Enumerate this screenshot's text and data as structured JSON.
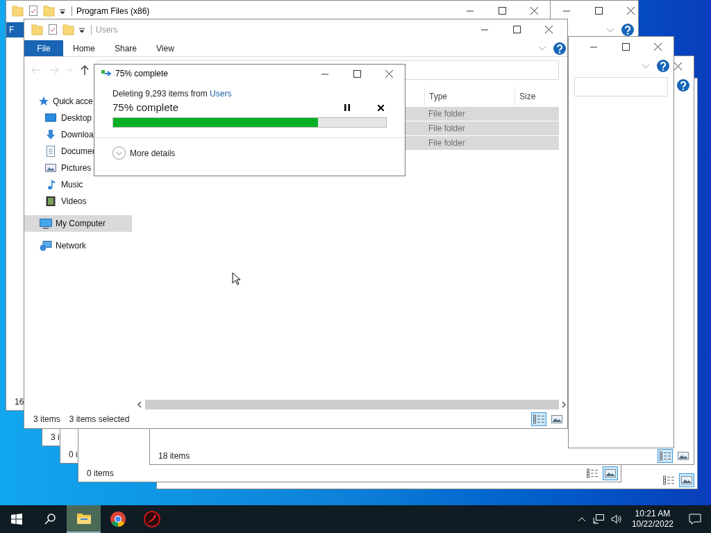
{
  "background_windows": [
    {
      "kind": "edge",
      "details_view": false
    },
    {
      "kind": "explorer",
      "title": "Program Files (x86)",
      "tab": "F",
      "status": "16"
    },
    {
      "kind": "corner"
    },
    {
      "kind": "plain",
      "status": "3 i"
    },
    {
      "kind": "plain",
      "status": "0 i"
    },
    {
      "kind": "plain",
      "status": "0 items",
      "details_view": false
    },
    {
      "kind": "plain",
      "status": "18 items",
      "details_view": true
    },
    {
      "kind": "side"
    }
  ],
  "window": {
    "title": "Users",
    "tabs": [
      {
        "label": "File",
        "selected": true
      },
      {
        "label": "Home",
        "selected": false
      },
      {
        "label": "Share",
        "selected": false
      },
      {
        "label": "View",
        "selected": false
      }
    ],
    "nav": [
      {
        "label": "Quick acce",
        "kind": "star",
        "selected": false
      },
      {
        "label": "Desktop",
        "kind": "desktop",
        "selected": false
      },
      {
        "label": "Downloa",
        "kind": "download",
        "selected": false
      },
      {
        "label": "Documer",
        "kind": "document",
        "selected": false
      },
      {
        "label": "Pictures",
        "kind": "pictures",
        "selected": false
      },
      {
        "label": "Music",
        "kind": "music",
        "selected": false
      },
      {
        "label": "Videos",
        "kind": "videos",
        "selected": false
      },
      {
        "label": "My Computer",
        "kind": "computer",
        "selected": true
      },
      {
        "label": "Network",
        "kind": "network",
        "selected": false
      }
    ],
    "columns": [
      "Type",
      "Size"
    ],
    "rows": [
      {
        "type": "File folder",
        "selected": true
      },
      {
        "type": "File folder",
        "selected": true
      },
      {
        "type": "File folder",
        "selected": true
      }
    ],
    "status_bar": [
      "3 items",
      "3 items selected"
    ],
    "details_view": true
  },
  "dialog": {
    "title": "75% complete",
    "message": "Deleting 9,293 items from ",
    "source_link": "Users",
    "heading": "75% complete",
    "level": 0.75,
    "more_details": "More details"
  },
  "taskbar": {
    "apps": [
      {
        "kind": "explorer",
        "selected": true
      },
      {
        "kind": "chrome",
        "selected": false
      },
      {
        "kind": "red-app",
        "selected": false
      }
    ],
    "time": "10:21 AM",
    "date": "10/22/2022"
  }
}
